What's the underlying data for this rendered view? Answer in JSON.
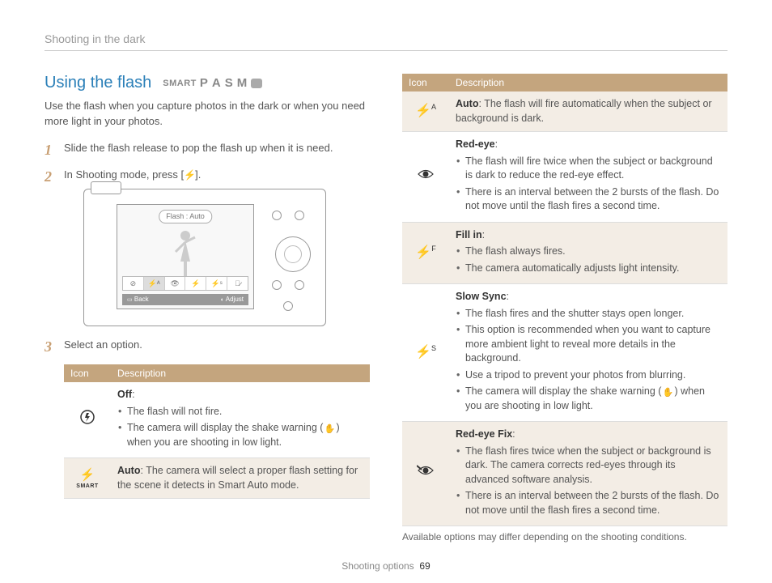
{
  "breadcrumb": "Shooting in the dark",
  "heading": "Using the flash",
  "modes": {
    "smart": "SMART",
    "p": "P",
    "a": "A",
    "s": "S",
    "m": "M"
  },
  "intro": "Use the flash when you capture photos in the dark or when you need more light in your photos.",
  "steps": {
    "s1": "Slide the flash release to pop the flash up when it is need.",
    "s2a": "In Shooting mode, press [",
    "s2b": "].",
    "s3": "Select an option."
  },
  "illus": {
    "flash_label": "Flash : Auto",
    "back": "Back",
    "adjust": "Adjust"
  },
  "table_hdr": {
    "icon": "Icon",
    "desc": "Description"
  },
  "left_rows": {
    "off": {
      "title": "Off",
      "b1": "The flash will not fire.",
      "b2a": "The camera will display the shake warning (",
      "b2b": ") when you are shooting in low light."
    },
    "smartauto": {
      "label_under": "SMART",
      "text": ": The camera will select a proper flash setting for the scene it detects in Smart Auto mode.",
      "bold": "Auto"
    }
  },
  "right_rows": {
    "auto": {
      "bold": "Auto",
      "text": ": The flash will fire automatically when the subject or background is dark."
    },
    "redeye": {
      "title": "Red-eye",
      "b1": "The flash will fire twice when the subject or background is dark to reduce the red-eye effect.",
      "b2": "There is an interval between the 2 bursts of the flash. Do not move until the flash fires a second time."
    },
    "fillin": {
      "title": "Fill in",
      "b1": "The flash always fires.",
      "b2": "The camera automatically adjusts light intensity."
    },
    "slowsync": {
      "title": "Slow Sync",
      "b1": "The flash fires and the shutter stays open longer.",
      "b2": "This option is recommended when you want to capture more ambient light to reveal more details in the background.",
      "b3": "Use a tripod to prevent your photos from blurring.",
      "b4a": "The camera will display the shake warning (",
      "b4b": ") when you are shooting in low light."
    },
    "redeyefix": {
      "title": "Red-eye Fix",
      "b1": "The flash fires twice when the subject or background is dark. The camera corrects red-eyes through its advanced software analysis.",
      "b2": "There is an interval between the 2 bursts of the flash. Do not move until the flash fires a second time."
    }
  },
  "footnote": "Available options may differ depending on the shooting conditions.",
  "footer": {
    "section": "Shooting options",
    "page": "69"
  }
}
